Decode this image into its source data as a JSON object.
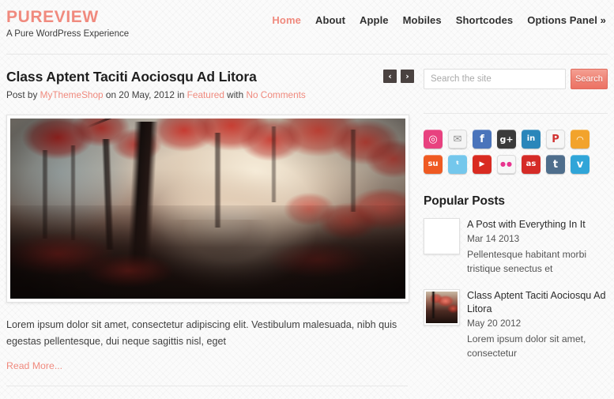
{
  "site": {
    "logo": "PUREVIEW",
    "tagline": "A Pure WordPress Experience",
    "accent_color": "#f08a7e"
  },
  "nav": {
    "items": [
      {
        "label": "Home",
        "active": true
      },
      {
        "label": "About",
        "active": false
      },
      {
        "label": "Apple",
        "active": false
      },
      {
        "label": "Mobiles",
        "active": false
      },
      {
        "label": "Shortcodes",
        "active": false
      },
      {
        "label": "Options Panel »",
        "active": false
      }
    ]
  },
  "post": {
    "title": "Class Aptent Taciti Aociosqu Ad Litora",
    "meta": {
      "prefix": "Post by",
      "author": "MyThemeShop",
      "on": "on 20 May, 2012",
      "in": "in",
      "category": "Featured",
      "with": "with",
      "comments": "No Comments"
    },
    "prev_arrow": "‹",
    "next_arrow": "›",
    "excerpt": "Lorem ipsum dolor sit amet, consectetur adipiscing elit. Vestibulum malesuada, nibh quis egestas pellentesque, dui neque sagittis nisl, eget",
    "read_more": "Read More..."
  },
  "search": {
    "placeholder": "Search the site",
    "value": "",
    "button_label": "Search"
  },
  "social": {
    "icons": [
      {
        "name": "dribbble-icon",
        "glyph": "◎",
        "bg": "#e8417f",
        "fg": "#ffffff"
      },
      {
        "name": "email-icon",
        "glyph": "✉",
        "bg": "#f4f4f4",
        "fg": "#8d8d8d"
      },
      {
        "name": "facebook-icon",
        "glyph": "f",
        "bg": "#4a74bb",
        "fg": "#ffffff"
      },
      {
        "name": "googleplus-icon",
        "glyph": "g+",
        "bg": "#3a3a3a",
        "fg": "#ffffff"
      },
      {
        "name": "linkedin-icon",
        "glyph": "in",
        "bg": "#2a86ba",
        "fg": "#ffffff"
      },
      {
        "name": "pinterest-icon",
        "glyph": "P",
        "bg": "#f6f6f6",
        "fg": "#d13130"
      },
      {
        "name": "rss-icon",
        "glyph": "◠",
        "bg": "#f2a32c",
        "fg": "#ffffff"
      },
      {
        "name": "stumbleupon-icon",
        "glyph": "su",
        "bg": "#ef5a22",
        "fg": "#ffffff"
      },
      {
        "name": "twitter-icon",
        "glyph": "ᵗ",
        "bg": "#74c7ec",
        "fg": "#ffffff"
      },
      {
        "name": "youtube-icon",
        "glyph": "▶",
        "bg": "#d92b21",
        "fg": "#ffffff"
      },
      {
        "name": "flickr-icon",
        "glyph": "●●",
        "bg": "#f7f7f7",
        "fg": "#e8368f"
      },
      {
        "name": "lastfm-icon",
        "glyph": "as",
        "bg": "#d52b27",
        "fg": "#ffffff"
      },
      {
        "name": "tumblr-icon",
        "glyph": "t",
        "bg": "#4f6e8c",
        "fg": "#ffffff"
      },
      {
        "name": "vimeo-icon",
        "glyph": "v",
        "bg": "#30a5d8",
        "fg": "#ffffff"
      }
    ]
  },
  "popular": {
    "title": "Popular Posts",
    "items": [
      {
        "title": "A Post with Everything In It",
        "date": "Mar 14 2013",
        "excerpt": "Pellentesque habitant morbi tristique senectus et",
        "thumb": "flower"
      },
      {
        "title": "Class Aptent Taciti Aociosqu Ad Litora",
        "date": "May 20 2012",
        "excerpt": "Lorem ipsum dolor sit amet, consectetur",
        "thumb": "forest"
      }
    ]
  }
}
